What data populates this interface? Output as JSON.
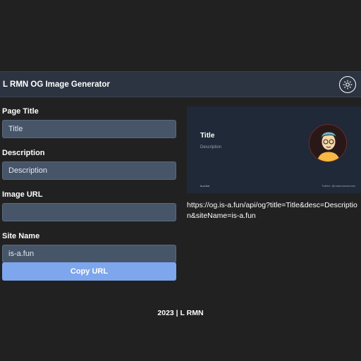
{
  "header": {
    "title": "L RMN OG Image Generator",
    "theme_icon": "sun-icon"
  },
  "form": {
    "page_title_label": "Page Title",
    "page_title_placeholder": "Title",
    "page_title_value": "",
    "description_label": "Description",
    "description_placeholder": "Description",
    "description_value": "",
    "image_url_label": "Image URL",
    "image_url_value": "",
    "site_name_label": "Site Name",
    "site_name_value": "is-a.fun",
    "copy_label": "Copy URL"
  },
  "preview": {
    "title": "Title",
    "description": "Description",
    "site": "is-a.fun",
    "twitter": "Twitter: @notaroomservice"
  },
  "url": "https://og.is-a.fun/api/og?title=Title&desc=Description&siteName=is-a.fun",
  "footer": "2023 | L RMN",
  "colors": {
    "background": "#212121",
    "header": "#2c3441",
    "input": "#475569",
    "button": "#7ea6ec",
    "preview": "#1f2937"
  }
}
